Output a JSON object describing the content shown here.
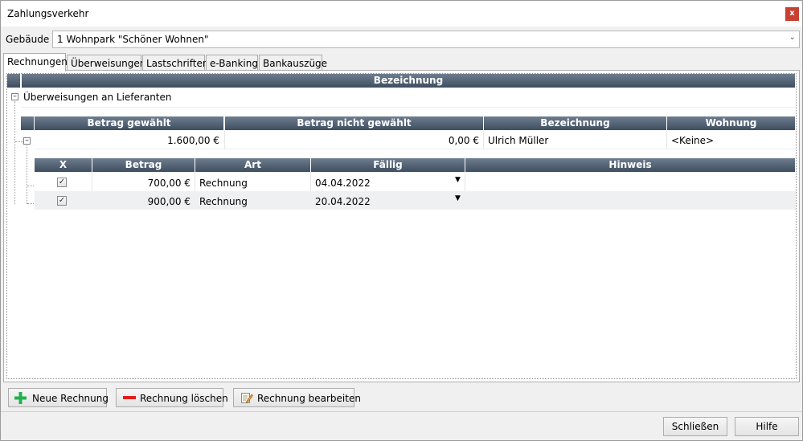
{
  "window": {
    "title": "Zahlungsverkehr",
    "close_label": "x"
  },
  "gebaeude": {
    "label": "Gebäude",
    "value": "1 Wohnpark \"Schöner Wohnen\""
  },
  "tabs": [
    {
      "label": "Rechnungen"
    },
    {
      "label": "Überweisungen"
    },
    {
      "label": "Lastschriften"
    },
    {
      "label": "e-Banking"
    },
    {
      "label": "Bankauszüge"
    }
  ],
  "grid": {
    "header": "Bezeichnung",
    "group": {
      "label": "Überweisungen an Lieferanten"
    },
    "level2": {
      "columns": [
        "Betrag gewählt",
        "Betrag nicht gewählt",
        "Bezeichnung",
        "Wohnung"
      ],
      "row": {
        "betrag_gewaehlt": "1.600,00 €",
        "betrag_nicht_gewaehlt": "0,00 €",
        "bezeichnung": "Ulrich Müller",
        "wohnung": "<Keine>"
      }
    },
    "level3": {
      "columns": [
        "X",
        "Betrag",
        "Art",
        "Fällig",
        "Hinweis"
      ],
      "rows": [
        {
          "checked": "✓",
          "betrag": "700,00 €",
          "art": "Rechnung",
          "faellig": "04.04.2022",
          "hinweis": ""
        },
        {
          "checked": "✓",
          "betrag": "900,00 €",
          "art": "Rechnung",
          "faellig": "20.04.2022",
          "hinweis": ""
        }
      ]
    }
  },
  "actions": {
    "new": "Neue Rechnung",
    "delete": "Rechnung löschen",
    "edit": "Rechnung bearbeiten"
  },
  "footer": {
    "close": "Schließen",
    "help": "Hilfe"
  },
  "colors": {
    "add_icon": "#22b14c",
    "delete_icon": "#e0201c",
    "header_bg": "#4a5a6c"
  }
}
